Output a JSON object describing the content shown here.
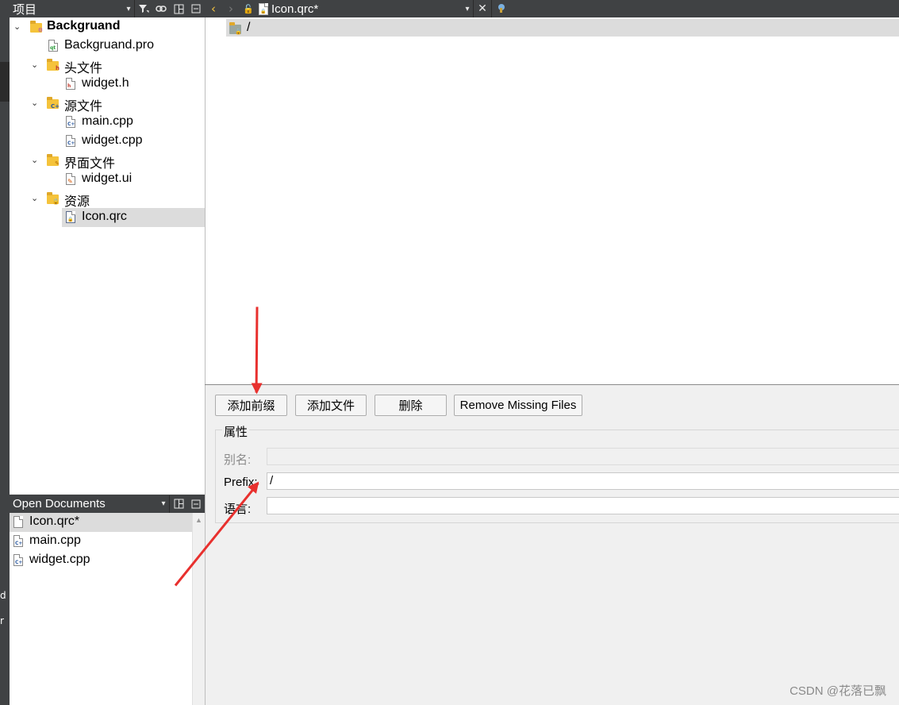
{
  "project_panel": {
    "title": "项目",
    "tree": [
      {
        "label": "Backgruand",
        "kind": "project"
      },
      {
        "label": "Backgruand.pro",
        "kind": "pro-file"
      },
      {
        "label": "头文件",
        "kind": "folder-h"
      },
      {
        "label": "widget.h",
        "kind": "h-file"
      },
      {
        "label": "源文件",
        "kind": "folder-cpp"
      },
      {
        "label": "main.cpp",
        "kind": "cpp-file"
      },
      {
        "label": "widget.cpp",
        "kind": "cpp-file"
      },
      {
        "label": "界面文件",
        "kind": "folder-ui"
      },
      {
        "label": "widget.ui",
        "kind": "ui-file"
      },
      {
        "label": "资源",
        "kind": "folder-res"
      },
      {
        "label": "Icon.qrc",
        "kind": "qrc-file",
        "selected": true
      }
    ]
  },
  "open_documents": {
    "title": "Open Documents",
    "items": [
      {
        "label": "Icon.qrc*",
        "kind": "doc-file",
        "selected": true
      },
      {
        "label": "main.cpp",
        "kind": "cpp-file"
      },
      {
        "label": "widget.cpp",
        "kind": "cpp-file"
      }
    ]
  },
  "editor": {
    "file_label": "Icon.qrc*",
    "prefix_item": "/",
    "buttons": {
      "add_prefix": "添加前缀",
      "add_files": "添加文件",
      "delete": "删除",
      "remove_missing": "Remove Missing Files"
    },
    "properties": {
      "legend": "属性",
      "alias_label": "别名:",
      "alias_value": "",
      "prefix_label": "Prefix:",
      "prefix_value": "/",
      "language_label": "语言:",
      "language_value": ""
    }
  },
  "left_strip_glyphs": [
    "d",
    "r"
  ],
  "watermark": "CSDN @花落已飘",
  "colors": {
    "panel_header": "#404244",
    "selection": "#dcdcdc",
    "annotation_arrow": "#e8302e",
    "folder": "#f5c33b"
  }
}
